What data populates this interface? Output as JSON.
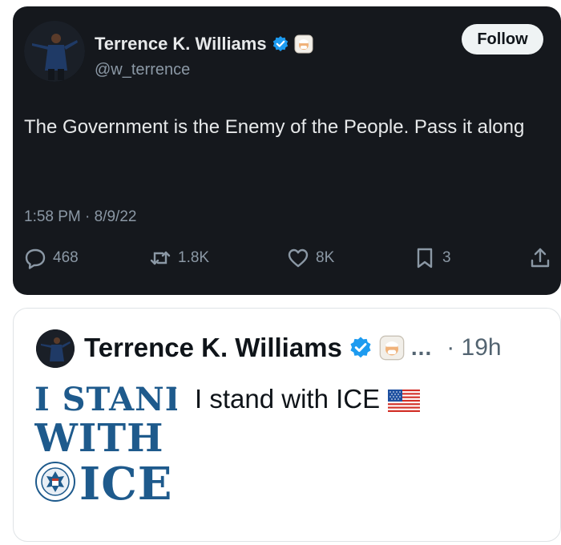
{
  "dark_tweet": {
    "author_name": "Terrence K. Williams",
    "handle": "@w_terrence",
    "follow_label": "Follow",
    "text": "The Government is the Enemy of the People. Pass it along",
    "timestamp": "1:58 PM · 8/9/22",
    "stats": {
      "replies": "468",
      "retweets": "1.8K",
      "likes": "8K",
      "bookmarks": "3"
    },
    "colors": {
      "background": "#15181d",
      "verified": "#1d9bf0",
      "muted": "#8b98a5"
    }
  },
  "light_tweet": {
    "author_name": "Terrence K. Williams",
    "ellipsis": "...",
    "time": "· 19h",
    "text": "I stand with ICE",
    "image": {
      "line1": "I STAND",
      "line2": "WITH",
      "line3": "ICE",
      "brand_color": "#1e5a8c"
    }
  }
}
